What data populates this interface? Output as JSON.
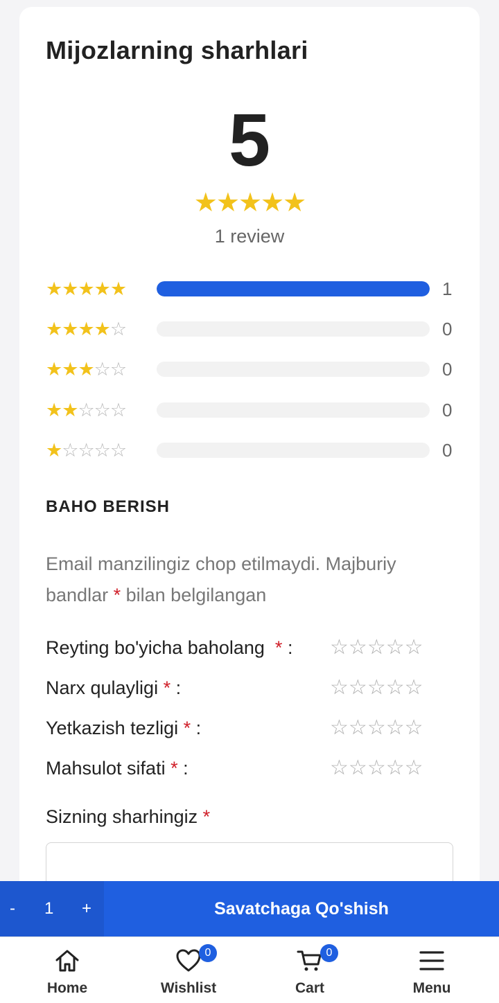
{
  "reviews": {
    "title": "Mijozlarning sharhlari",
    "average": "5",
    "average_stars": 5,
    "review_count_text": "1 review",
    "distribution": [
      {
        "stars": 5,
        "count": "1",
        "fraction": 1.0
      },
      {
        "stars": 4,
        "count": "0",
        "fraction": 0
      },
      {
        "stars": 3,
        "count": "0",
        "fraction": 0
      },
      {
        "stars": 2,
        "count": "0",
        "fraction": 0
      },
      {
        "stars": 1,
        "count": "0",
        "fraction": 0
      }
    ]
  },
  "form": {
    "heading": "BAHO BERISH",
    "notice_before": "Email manzilingiz chop etilmaydi. Majburiy bandlar",
    "notice_after": "bilan belgilangan",
    "required_mark": "*",
    "ratings": [
      {
        "label": "Reyting bo'yicha baholang",
        "suffix": ":"
      },
      {
        "label": "Narx qulayligi",
        "suffix": ":"
      },
      {
        "label": "Yetkazish tezligi",
        "suffix": ":"
      },
      {
        "label": "Mahsulot sifati",
        "suffix": ":"
      }
    ],
    "your_review_label": "Sizning sharhingiz"
  },
  "cartbar": {
    "minus": "-",
    "quantity": "1",
    "plus": "+",
    "add_label": "Savatchaga Qo'shish"
  },
  "nav": {
    "home": "Home",
    "wishlist": "Wishlist",
    "wishlist_count": "0",
    "cart": "Cart",
    "cart_count": "0",
    "menu": "Menu"
  },
  "colors": {
    "accent": "#1f5fe0",
    "star": "#f2c21b",
    "required": "#d0202a"
  },
  "icons": [
    "home-icon",
    "heart-icon",
    "cart-icon",
    "menu-icon",
    "star-icon"
  ]
}
